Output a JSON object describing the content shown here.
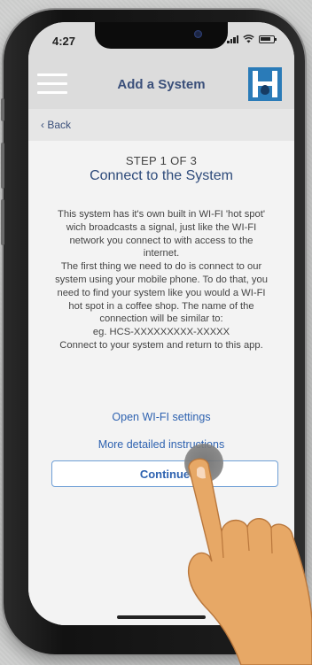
{
  "status_bar": {
    "time": "4:27"
  },
  "header": {
    "title": "Add a System",
    "menu_icon": "hamburger-icon",
    "logo_icon": "company-logo"
  },
  "nav": {
    "back_label": "Back",
    "back_icon": "chevron-left-icon"
  },
  "main": {
    "step": "STEP 1 OF 3",
    "title": "Connect to the System",
    "body_lines": [
      "This system has it's own built in WI-FI 'hot spot'",
      "wich broadcasts a signal, just like the WI-FI",
      "network you connect to with access to the",
      "internet.",
      "The first thing we need to do is connect to our",
      "system using your mobile phone. To do that, you",
      "need to find your system like you would a WI-FI",
      "hot spot in a coffee shop. The name of the",
      "connection will be similar to:",
      "eg. HCS-XXXXXXXXX-XXXXX",
      "Connect to your system and return to this app."
    ],
    "open_wifi_label": "Open WI-FI settings",
    "instructions_label": "More detailed instructions",
    "continue_label": "Continue"
  },
  "colors": {
    "accent": "#2e62b0",
    "header_title": "#3a4f7a",
    "logo": "#2a7bb8"
  }
}
